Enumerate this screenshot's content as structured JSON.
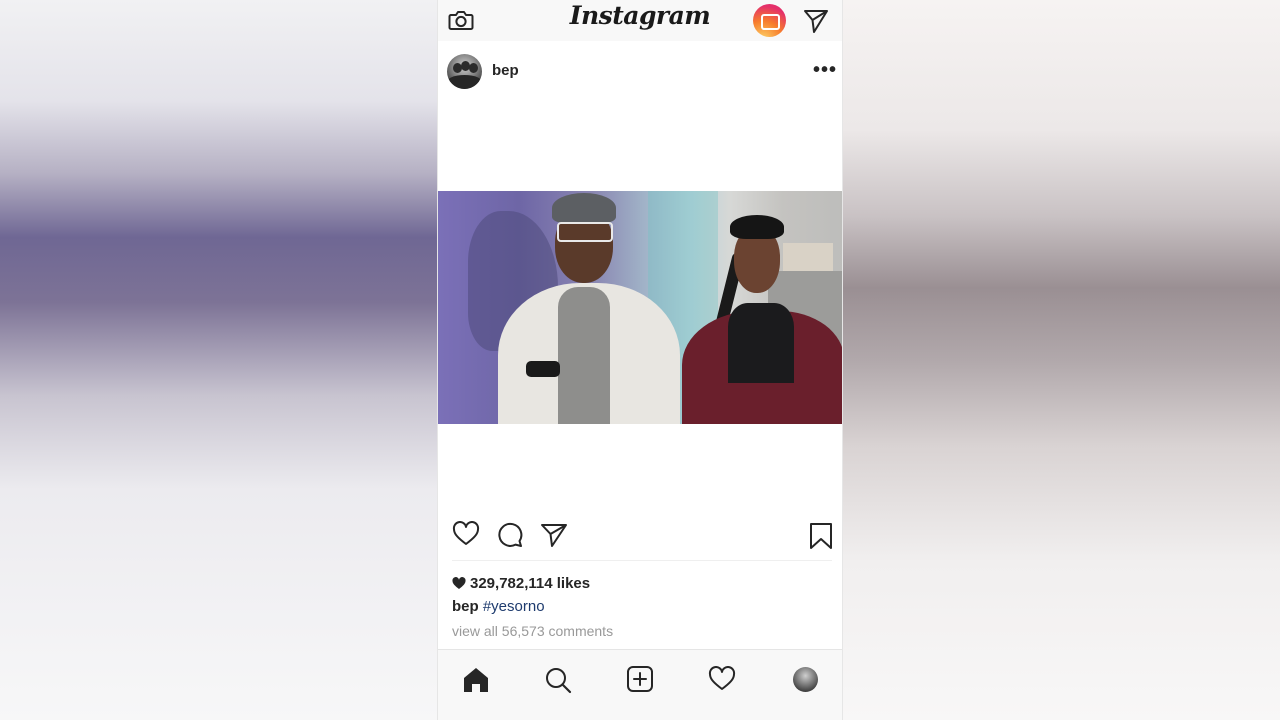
{
  "app": {
    "logo_text": "Instagram"
  },
  "post": {
    "username": "bep",
    "likes": "329,782,114 likes",
    "caption_user": "bep",
    "caption_hashtag": "#yesorno",
    "comments_link": "view all 56,573 comments"
  },
  "icons": {
    "top_left": "camera-icon",
    "top_igtv": "igtv-icon",
    "top_right": "direct-send-icon",
    "post_more": "more-options-icon",
    "actions": [
      "heart-icon",
      "comment-icon",
      "share-icon",
      "bookmark-icon"
    ],
    "nav": [
      "home-icon",
      "search-icon",
      "add-post-icon",
      "activity-heart-icon",
      "profile-avatar"
    ]
  },
  "colors": {
    "hashtag": "#1e3b6e",
    "muted_text": "#999999",
    "igtv_gradient": [
      "#fdd66a",
      "#f77d2c",
      "#e42f6a"
    ]
  }
}
